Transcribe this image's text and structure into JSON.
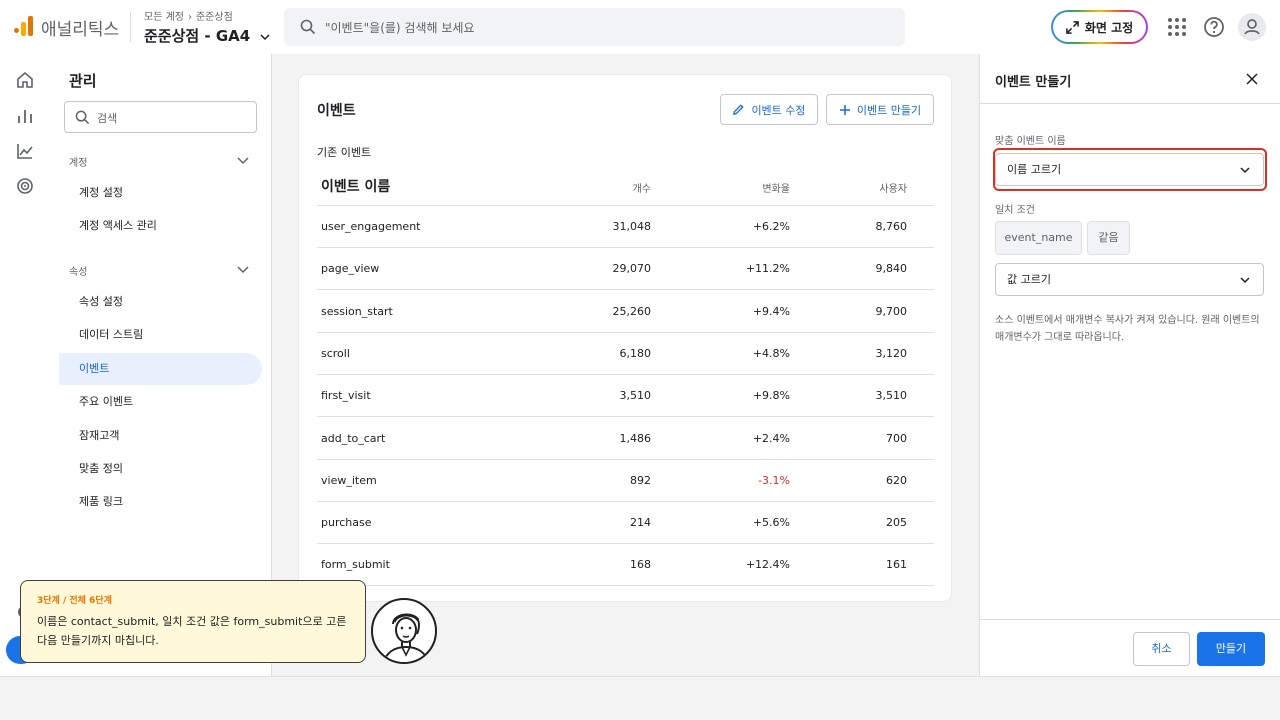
{
  "app": {
    "name": "애널리틱스"
  },
  "breadcrumb": {
    "account": "모든 계정",
    "property": "준준상점"
  },
  "property_selector": {
    "label": "준준상점 - GA4"
  },
  "search": {
    "placeholder": "\"이벤트\"을(를) 검색해 보세요"
  },
  "pin_button": {
    "label": "화면 고정"
  },
  "admin_nav": {
    "title": "관리",
    "search_placeholder": "검색",
    "sections": [
      {
        "label": "계정",
        "items": [
          "계정 설정",
          "계정 액세스 관리"
        ]
      },
      {
        "label": "속성",
        "items": [
          "속성 설정",
          "데이터 스트림",
          "이벤트",
          "주요 이벤트",
          "잠재고객",
          "맞춤 정의",
          "제품 링크"
        ]
      }
    ],
    "active_item": "이벤트"
  },
  "events_card": {
    "title": "이벤트",
    "edit_button": "이벤트 수정",
    "create_button": "이벤트 만들기",
    "subtitle": "기존 이벤트",
    "columns": [
      "이벤트 이름",
      "개수",
      "변화율",
      "사용자"
    ],
    "rows": [
      {
        "name": "user_engagement",
        "count": "31,048",
        "change": "+6.2%",
        "users": "8,760"
      },
      {
        "name": "page_view",
        "count": "29,070",
        "change": "+11.2%",
        "users": "9,840"
      },
      {
        "name": "session_start",
        "count": "25,260",
        "change": "+9.4%",
        "users": "9,700"
      },
      {
        "name": "scroll",
        "count": "6,180",
        "change": "+4.8%",
        "users": "3,120"
      },
      {
        "name": "first_visit",
        "count": "3,510",
        "change": "+9.8%",
        "users": "3,510"
      },
      {
        "name": "add_to_cart",
        "count": "1,486",
        "change": "+2.4%",
        "users": "700"
      },
      {
        "name": "view_item",
        "count": "892",
        "change": "-3.1%",
        "users": "620"
      },
      {
        "name": "purchase",
        "count": "214",
        "change": "+5.6%",
        "users": "205"
      },
      {
        "name": "form_submit",
        "count": "168",
        "change": "+12.4%",
        "users": "161"
      }
    ]
  },
  "create_panel": {
    "title": "이벤트 만들기",
    "custom_name_label": "맞춤 이벤트 이름",
    "name_select": "이름 고르기",
    "condition_label": "일치 조건",
    "condition_param": "event_name",
    "condition_operator": "같음",
    "value_select": "값 고르기",
    "help_text": "소스 이벤트에서 매개변수 복사가 켜져 있습니다. 원래 이벤트의 매개변수가 그대로 따라옵니다.",
    "cancel_button": "취소",
    "create_button": "만들기"
  },
  "tutorial": {
    "step": "3단계 / 전체 6단계",
    "message": "이름은 contact_submit, 일치 조건 값은 form_submit으로 고른 다음 만들기까지 마칩니다."
  },
  "colors": {
    "accent": "#1a73e8",
    "active_nav_bg": "#e8f0fe",
    "negative": "#d93025",
    "highlight": "#d93025",
    "tutorial_bg": "#fff8d9",
    "step_label": "#e37400"
  }
}
